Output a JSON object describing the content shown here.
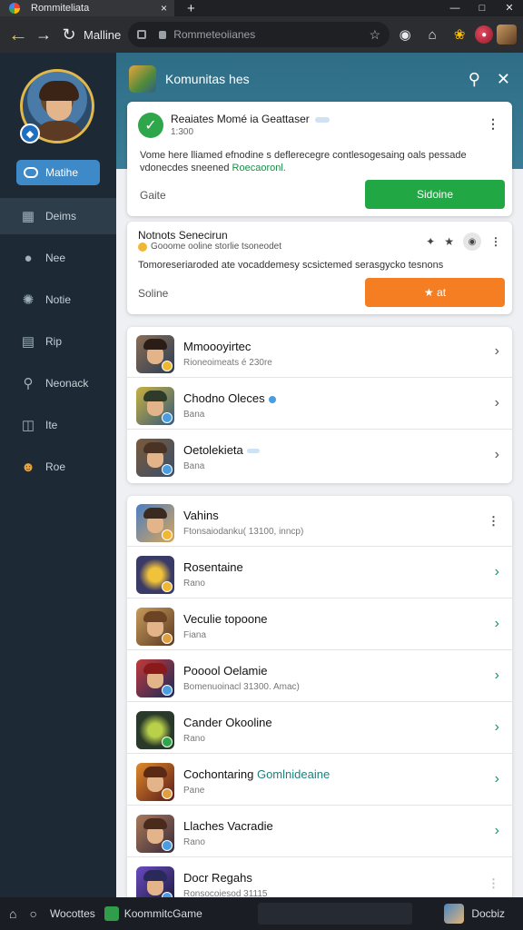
{
  "browser": {
    "tab_title": "Rommiteliata",
    "tab_close": "×",
    "new_tab": "+",
    "window_controls": [
      "—",
      "□",
      "✕"
    ],
    "nav_label": "Malline",
    "url": "Rommeteoiianes",
    "icons": [
      "back-arrow-icon",
      "forward-arrow-icon",
      "reload-icon",
      "star-icon"
    ]
  },
  "sidebar": {
    "profile_button": "Matihe",
    "items": [
      {
        "label": "Deims",
        "icon": "grid-icon",
        "active": true
      },
      {
        "label": "Nee",
        "icon": "chat-icon",
        "active": false
      },
      {
        "label": "Notie",
        "icon": "puzzle-icon",
        "active": false
      },
      {
        "label": "Rip",
        "icon": "document-icon",
        "active": false
      },
      {
        "label": "Neonack",
        "icon": "search-icon",
        "active": false
      },
      {
        "label": "Ite",
        "icon": "table-icon",
        "active": false
      },
      {
        "label": "Roe",
        "icon": "smiley-icon",
        "active": false
      }
    ]
  },
  "header": {
    "title": "Komunitas hes"
  },
  "card1": {
    "title": "Reaiates Momé ia Geattaser",
    "subtitle": "1:300",
    "body": "Vome here lliamed efnodine s deflerecegre contlesogesaing oals pessade",
    "body_line2_plain": "vdonecdes sneened",
    "body_link": "Roecaoronl.",
    "left_label": "Gaite",
    "button": "Sidoine"
  },
  "card2": {
    "title": "Notnots Senecirun",
    "subtitle": "Gooome ooline storlie tsoneodet",
    "body": "Tomoreseriaroded ate vocaddemesy scsictemed serasgycko tesnons",
    "left_label": "Soline",
    "button": "★ at"
  },
  "list1": [
    {
      "title": "Mmoooyirtec",
      "sub": "Rioneoimeats é 230re",
      "badge": "#f0b733"
    },
    {
      "title": "Chodno Oleces",
      "sub": "Bana",
      "badge": "#4a9ee0"
    },
    {
      "title": "Oetolekieta",
      "sub": "Bana",
      "badge": "#4a9ee0"
    }
  ],
  "list2": [
    {
      "title": "Vahins",
      "sub": "Ftonsaiodanku( 13100, inncp)",
      "badge": "#f0b733"
    },
    {
      "title": "Rosentaine",
      "sub": "Rano",
      "badge": "#f0b733"
    },
    {
      "title": "Veculie topoone",
      "sub": "Fiana",
      "badge": "#e0a040"
    },
    {
      "title": "Pooool Oelamie",
      "sub": "Bomenuoinacl 31300. Amac)",
      "badge": "#4a9ee0"
    },
    {
      "title": "Cander Okooline",
      "sub": "Rano",
      "badge": "#2ea64a"
    },
    {
      "title": "Cochontaring",
      "title_accent": "Gomlnideaine",
      "sub": "Pane",
      "badge": "#e0a040"
    },
    {
      "title": "Llaches Vacradie",
      "sub": "Rano",
      "badge": "#4a9ee0"
    },
    {
      "title": "Docr Regahs",
      "sub": "Ronsocoiesod 31115",
      "badge": "#4a9ee0"
    }
  ],
  "taskbar": {
    "label1": "Wocottes",
    "app_label": "KoommitcGame",
    "right_label": "Docbiz"
  }
}
